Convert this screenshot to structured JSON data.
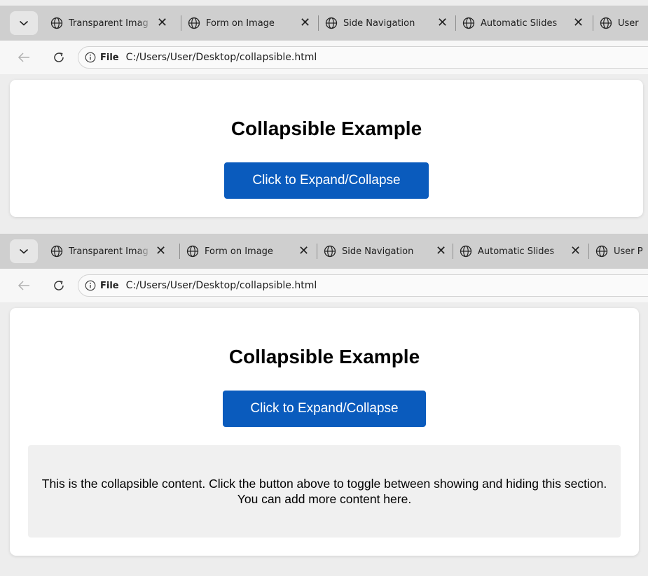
{
  "tabs": [
    {
      "label": "Transparent Imag"
    },
    {
      "label": "Form on Image"
    },
    {
      "label": "Side Navigation"
    },
    {
      "label": "Automatic Slides"
    },
    {
      "label": "User"
    }
  ],
  "tabs_second": [
    {
      "label": "Transparent Imag"
    },
    {
      "label": "Form on Image"
    },
    {
      "label": "Side Navigation"
    },
    {
      "label": "Automatic Slides"
    },
    {
      "label": "User P"
    }
  ],
  "tab_close_glyph": "✕",
  "address": {
    "scheme": "File",
    "url": "C:/Users/User/Desktop/collapsible.html"
  },
  "page": {
    "heading": "Collapsible Example",
    "button_label": "Click to Expand/Collapse",
    "content_text": "This is the collapsible content. Click the button above to toggle between showing and hiding this section. You can add more content here."
  },
  "colors": {
    "button_bg": "#0a5bbd",
    "content_bg": "#f0f0f0"
  },
  "icons": {
    "tab_icon": "globe-icon",
    "back": "arrow-left-icon",
    "reload": "reload-icon",
    "site_info": "info-icon",
    "tab_menu": "chevron-down-icon",
    "close": "close-icon"
  }
}
